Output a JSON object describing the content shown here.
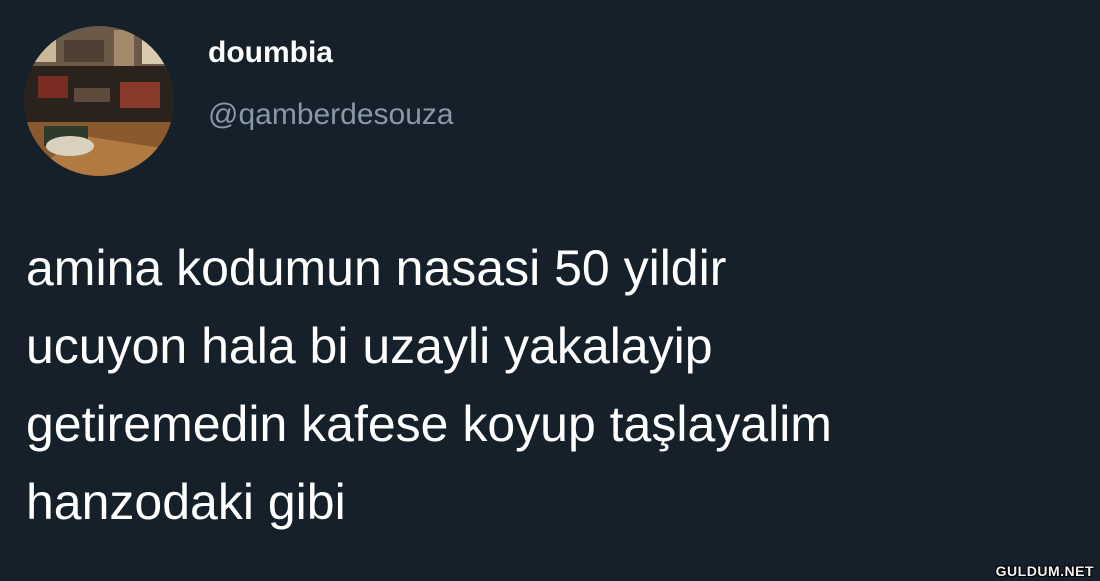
{
  "author": {
    "display_name": "doumbia",
    "handle": "@qamberdesouza",
    "avatar_icon": "avatar-photo-room"
  },
  "tweet": {
    "text": "amina kodumun nasasi 50 yildir\nucuyon hala bi uzayli yakalayip\ngetiremedin kafese koyup taşlayalim\nhanzodaki gibi"
  },
  "watermark": "GULDUM.NET",
  "colors": {
    "background": "#15202b",
    "primary_text": "#ffffff",
    "secondary_text": "#8899a6"
  }
}
